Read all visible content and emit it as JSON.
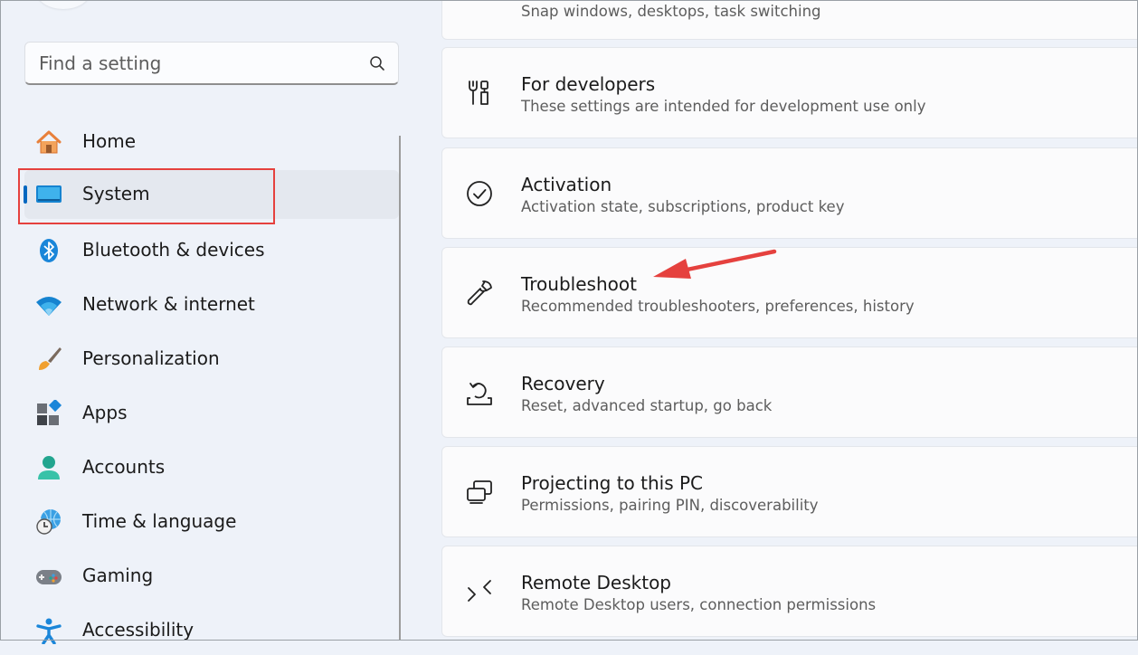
{
  "search": {
    "placeholder": "Find a setting",
    "icon": "search-icon"
  },
  "sidebar": {
    "items": [
      {
        "label": "Home",
        "icon": "home-icon"
      },
      {
        "label": "System",
        "icon": "system-monitor-icon",
        "selected": true
      },
      {
        "label": "Bluetooth & devices",
        "icon": "bluetooth-icon"
      },
      {
        "label": "Network & internet",
        "icon": "wifi-icon"
      },
      {
        "label": "Personalization",
        "icon": "paintbrush-icon"
      },
      {
        "label": "Apps",
        "icon": "apps-icon"
      },
      {
        "label": "Accounts",
        "icon": "person-icon"
      },
      {
        "label": "Time & language",
        "icon": "globe-clock-icon"
      },
      {
        "label": "Gaming",
        "icon": "gamepad-icon"
      },
      {
        "label": "Accessibility",
        "icon": "accessibility-icon"
      }
    ]
  },
  "main": {
    "cards": [
      {
        "title": "",
        "subtitle": "Snap windows, desktops, task switching",
        "icon": "multitasking-icon"
      },
      {
        "title": "For developers",
        "subtitle": "These settings are intended for development use only",
        "icon": "developer-tools-icon"
      },
      {
        "title": "Activation",
        "subtitle": "Activation state, subscriptions, product key",
        "icon": "check-circle-icon"
      },
      {
        "title": "Troubleshoot",
        "subtitle": "Recommended troubleshooters, preferences, history",
        "icon": "wrench-icon"
      },
      {
        "title": "Recovery",
        "subtitle": "Reset, advanced startup, go back",
        "icon": "recovery-icon"
      },
      {
        "title": "Projecting to this PC",
        "subtitle": "Permissions, pairing PIN, discoverability",
        "icon": "projecting-icon"
      },
      {
        "title": "Remote Desktop",
        "subtitle": "Remote Desktop users, connection permissions",
        "icon": "remote-desktop-icon"
      }
    ]
  },
  "colors": {
    "accent": "#0067c0",
    "annotation": "#e5413e"
  }
}
